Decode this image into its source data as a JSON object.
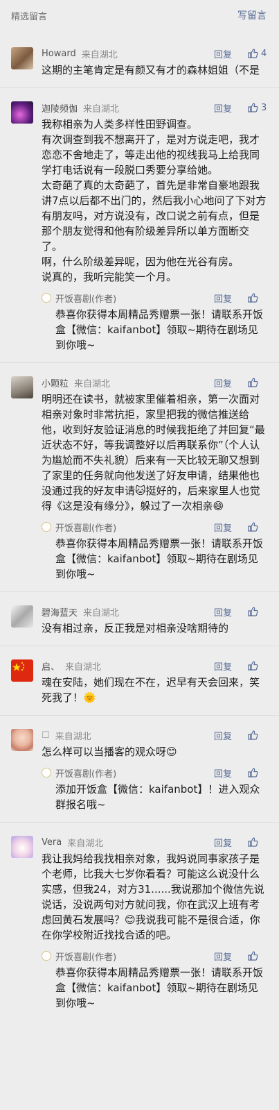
{
  "header": {
    "title": "精选留言",
    "write": "写留言"
  },
  "colors": {
    "link": "#576b95",
    "bg": "#ededed"
  },
  "comments": [
    {
      "nick": "Howard",
      "from": "来自湖北",
      "reply": "回复",
      "likes": "4",
      "text": "这期的主笔肯定是有颜又有才的森林姐姐（不是",
      "avatar": "photo-avatar"
    },
    {
      "nick": "迦陵频伽",
      "from": "来自湖北",
      "reply": "回复",
      "likes": "3",
      "text": "我称相亲为人类多样性田野调查。\n有次调查到我不想离开了，是对方说走吧，我才恋恋不舍地走了，等走出他的视线我马上给我同学打电话说有一段脱口秀要分享给她。\n太奇葩了真的太奇葩了，首先是非常自豪地跟我讲7点以后都不出门的，然后我小心地问了下对方有朋友吗，对方说没有，改口说之前有点，但是那个朋友觉得和他有阶级差异所以单方面断交了。\n啊，什么阶级差异呢，因为他在光谷有房。\n说真的，我听完能笑一个月。",
      "avatar": "purple-avatar",
      "author_reply": {
        "nick": "开饭喜剧(作者)",
        "reply": "回复",
        "text": "恭喜你获得本周精品秀赠票一张！请联系开饭盒【微信：kaifanbot】领取~期待在剧场见到你哦~"
      }
    },
    {
      "nick": "小颗粒",
      "from": "来自湖北",
      "reply": "回复",
      "likes": "",
      "text": "明明还在读书，就被家里催着相亲，第一次面对相亲对象时非常抗拒，家里把我的微信推送给他，收到好友验证消息的时候我拒绝了并回复“最近状态不好，等我调整好以后再联系你”（个人认为尴尬而不失礼貌）后来有一天比较无聊又想到了家里的任务就向他发送了好友申请，结果他也没通过我的好友申请🐱挺好的，后来家里人也觉得《这是没有缘分》，躲过了一次相亲😄",
      "avatar": "cat-avatar",
      "author_reply": {
        "nick": "开饭喜剧(作者)",
        "reply": "回复",
        "text": "恭喜你获得本周精品秀赠票一张！请联系开饭盒【微信：kaifanbot】领取~期待在剧场见到你哦~"
      }
    },
    {
      "nick": "碧海蓝天",
      "from": "来自湖北",
      "reply": "回复",
      "likes": "",
      "text": "没有相过亲，反正我是对相亲没啥期待的",
      "avatar": "sketch-avatar"
    },
    {
      "nick": "启、",
      "from": "来自湖北",
      "reply": "回复",
      "likes": "",
      "text": "魂在安陆，她们现在不在，迟早有天会回来，笑死我了！🌞",
      "avatar": "flag-avatar"
    },
    {
      "nick": "☐",
      "from": "来自湖北",
      "reply": "回复",
      "likes": "",
      "text": "怎么样可以当播客的观众呀😊",
      "avatar": "girl-avatar",
      "author_reply": {
        "nick": "开饭喜剧(作者)",
        "reply": "回复",
        "text": "添加开饭盒【微信：kaifanbot】！进入观众群报名哦~"
      }
    },
    {
      "nick": "Vera",
      "from": "来自湖北",
      "reply": "回复",
      "likes": "",
      "text": "我让我妈给我找相亲对象，我妈说同事家孩子是个老师，比我大七岁你看看？可能这么说没什么实感，但我24，对方31......我说那加个微信先说说话，没说两句对方就问我，你在武汉上班有考虑回黄石发展吗？😊我说我可能不是很合适，你在你学校附近找找合适的吧。",
      "avatar": "bunny-avatar",
      "author_reply": {
        "nick": "开饭喜剧(作者)",
        "reply": "回复",
        "text": "恭喜你获得本周精品秀赠票一张！请联系开饭盒【微信：kaifanbot】领取~期待在剧场见到你哦~"
      }
    }
  ]
}
